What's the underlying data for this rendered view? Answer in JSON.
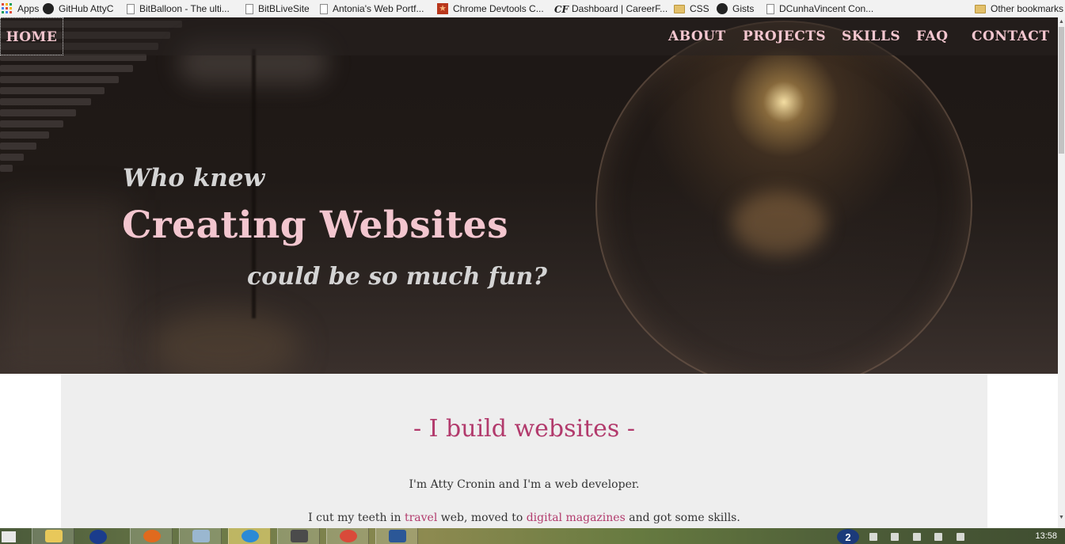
{
  "bookmarks": [
    {
      "label": "Apps",
      "icon": "apps-grid-icon"
    },
    {
      "label": "GitHub AttyC",
      "icon": "github-icon"
    },
    {
      "label": "BitBalloon - The ulti...",
      "icon": "page-icon"
    },
    {
      "label": "BitBLiveSite",
      "icon": "page-icon"
    },
    {
      "label": "Antonia's Web Portf...",
      "icon": "page-icon"
    },
    {
      "label": "Chrome Devtools C...",
      "icon": "star-icon"
    },
    {
      "label": "Dashboard | CareerF...",
      "icon": "careerfoundry-icon"
    },
    {
      "label": "CSS",
      "icon": "folder-icon"
    },
    {
      "label": "Gists",
      "icon": "github-icon"
    },
    {
      "label": "DCunhaVincent Con...",
      "icon": "page-icon"
    },
    {
      "label": "Other bookmarks",
      "icon": "folder-icon"
    }
  ],
  "nav": {
    "home": "HOME",
    "items": [
      "ABOUT",
      "PROJECTS",
      "SKILLS",
      "FAQ",
      "CONTACT"
    ]
  },
  "hero": {
    "line1": "Who knew",
    "line2": "Creating Websites",
    "line3": "could be so much fun?"
  },
  "content": {
    "heading": "- I build websites -",
    "intro": "I'm Atty Cronin and I'm a web developer.",
    "line2": {
      "part1": "I cut my teeth in ",
      "link1": "travel",
      "part2": " web, moved to ",
      "link2": "digital magazines",
      "part3": " and got some skills."
    }
  },
  "taskbar": {
    "clock": "13:58",
    "help_badge": "2"
  },
  "colors": {
    "accent_pink": "#f3c6cf",
    "heading_magenta": "#b23a6c",
    "panel_gray": "#eeeeee"
  }
}
